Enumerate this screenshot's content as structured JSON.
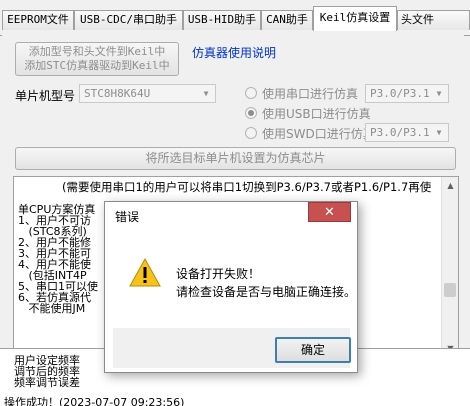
{
  "tabs": [
    "EEPROM文件",
    "USB-CDC/串口助手",
    "USB-HID助手",
    "CAN助手",
    "Keil仿真设置",
    "头文件"
  ],
  "active_tab": "Keil仿真设置",
  "panel": {
    "add_keil_button": [
      "添加型号和头文件到Keil中",
      "添加STC仿真器驱动到Keil中"
    ],
    "help_link": "仿真器使用说明",
    "mcu_label": "单片机型号",
    "mcu_value": "STC8H8K64U",
    "radio_serial": "使用串口进行仿真",
    "radio_usb": "使用USB口进行仿真",
    "radio_swd": "使用SWD口进行仿真",
    "serial_port_value": "P3.0/P3.1",
    "swd_port_value": "P3.0/P3.1",
    "set_chip_button": "将所选目标单片机设置为仿真芯片"
  },
  "textarea_lines": [
    "(需要使用串口1的用户可以将串口1切换到P3.6/P3.7或者P1.6/P1.7再使",
    "",
    "单CPU方案仿真",
    "1、用户不可访",
    "   (STC8系列)",
    "2、用户不能修",
    "3、用户不能可",
    "4、用户不能使",
    "   (包括INT4P",
    "5、串口1可以使",
    "6、若仿真源代",
    "   不能使用JM"
  ],
  "log_lines": [
    "用户设定频率",
    "调节后的频率",
    "频率调节误差",
    "操作成功！(2023-07-07 09:23:56)"
  ],
  "dialog": {
    "title": "错误",
    "close_icon": "✕",
    "message_line1": "设备打开失败！",
    "message_line2": "请检查设备是否与电脑正确连接。",
    "ok_label": "确定",
    "icon": "warning-icon"
  }
}
